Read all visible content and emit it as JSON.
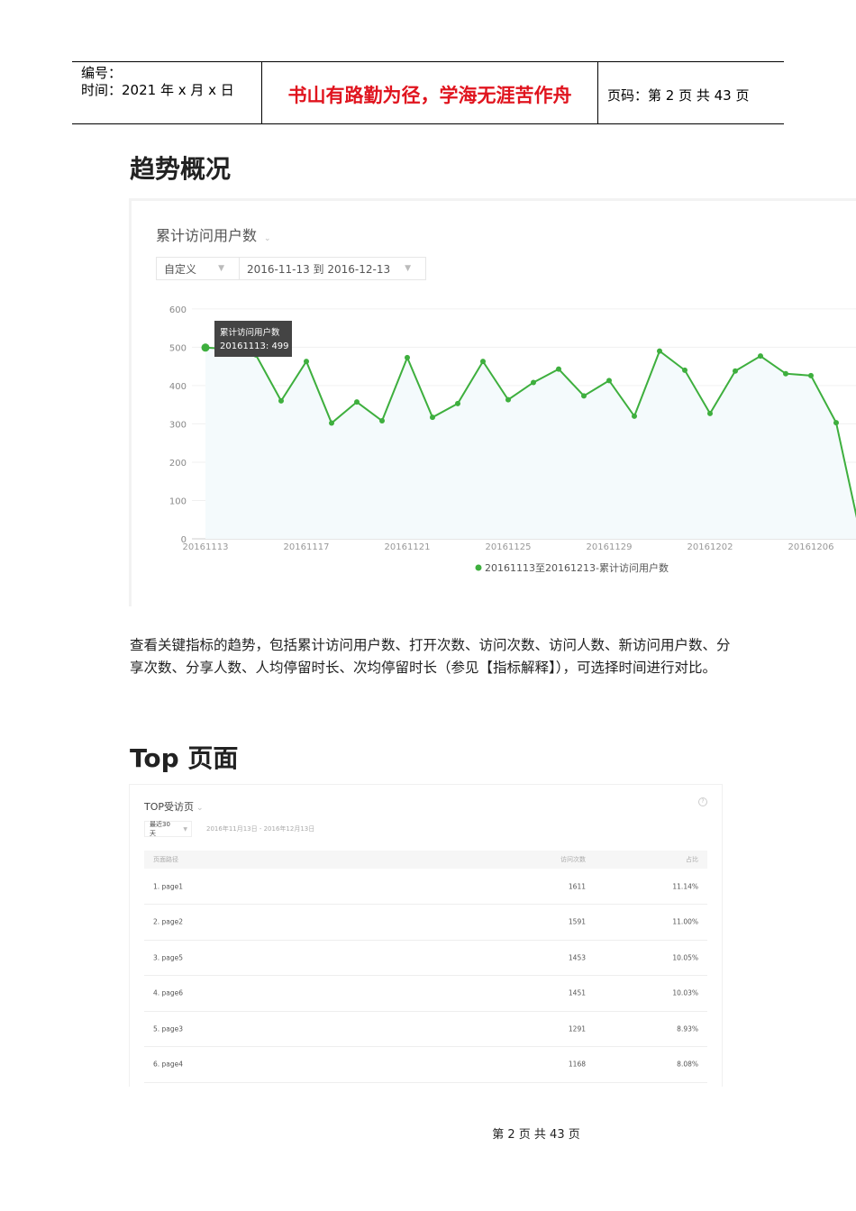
{
  "header": {
    "number_label": "编号：",
    "date": "时间：2021 年 x 月 x 日",
    "motto": "书山有路勤为径，学海无涯苦作舟",
    "page_info": "页码：第 2 页  共 43 页"
  },
  "section1": {
    "title": "趋势概况"
  },
  "chart_panel": {
    "metric": "累计访问用户数",
    "mode": "自定义",
    "date_range": "2016-11-13 到 2016-12-13",
    "tooltip_title": "累计访问用户数",
    "tooltip_value": "20161113: 499"
  },
  "chart_data": {
    "type": "line",
    "title": "累计访问用户数",
    "legend": "20161113至20161213-累计访问用户数",
    "legend_position": "bottom",
    "ylim": [
      0,
      600
    ],
    "yticks": [
      "0",
      "100",
      "200",
      "300",
      "400",
      "500",
      "600"
    ],
    "xticks": [
      "20161113",
      "20161117",
      "20161121",
      "20161125",
      "20161129",
      "20161202",
      "20161206"
    ],
    "x": [
      "20161113",
      "20161114",
      "20161115",
      "20161116",
      "20161117",
      "20161118",
      "20161119",
      "20161120",
      "20161121",
      "20161122",
      "20161123",
      "20161124",
      "20161125",
      "20161126",
      "20161127",
      "20161128",
      "20161129",
      "20161130",
      "20161201",
      "20161202",
      "20161203",
      "20161204",
      "20161205",
      "20161206",
      "20161207",
      "20161208",
      "20161209"
    ],
    "values": [
      499,
      495,
      480,
      360,
      463,
      302,
      357,
      308,
      473,
      317,
      353,
      463,
      363,
      408,
      443,
      373,
      413,
      320,
      490,
      440,
      327,
      438,
      477,
      431,
      426,
      303,
      0
    ],
    "color": "#3eaf3e",
    "grid": true
  },
  "description": "查看关键指标的趋势，包括累计访问用户数、打开次数、访问次数、访问人数、新访问用户数、分享次数、分享人数、人均停留时长、次均停留时长（参见【指标解释】），可选择时间进行对比。",
  "section2": {
    "title": "Top 页面"
  },
  "top_table": {
    "title": "TOP受访页",
    "help": "?",
    "period": "最近30天",
    "range": "2016年11月13日 - 2016年12月13日",
    "columns": [
      "页面路径",
      "访问次数",
      "占比"
    ],
    "rows": [
      [
        "1. page1",
        "1611",
        "11.14%"
      ],
      [
        "2. page2",
        "1591",
        "11.00%"
      ],
      [
        "3. page5",
        "1453",
        "10.05%"
      ],
      [
        "4. page6",
        "1451",
        "10.03%"
      ],
      [
        "5. page3",
        "1291",
        "8.93%"
      ],
      [
        "6. page4",
        "1168",
        "8.08%"
      ]
    ]
  },
  "footer": "第  2  页  共  43  页"
}
